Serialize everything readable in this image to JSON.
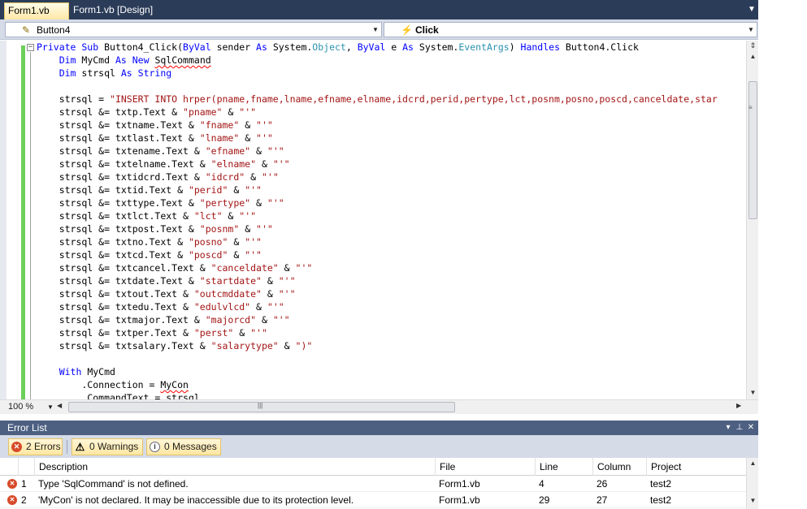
{
  "tabs": [
    {
      "label": "Form1.vb",
      "active": true
    },
    {
      "label": "Form1.vb [Design]",
      "active": false
    }
  ],
  "tab_menu_icon": "dropdown-arrow",
  "nav": {
    "object_combo": "Button4",
    "event_combo": "Click"
  },
  "editor": {
    "colors": {
      "keyword": "#0000ff",
      "string": "#a31515",
      "type": "#2b91af",
      "change_bar": "#6ccf5a"
    },
    "lines": [
      [
        {
          "t": "Private Sub",
          "c": "kw"
        },
        {
          "t": " Button4_Click("
        },
        {
          "t": "ByVal",
          "c": "kw"
        },
        {
          "t": " sender "
        },
        {
          "t": "As",
          "c": "kw"
        },
        {
          "t": " System."
        },
        {
          "t": "Object",
          "c": "typ"
        },
        {
          "t": ", "
        },
        {
          "t": "ByVal",
          "c": "kw"
        },
        {
          "t": " e "
        },
        {
          "t": "As",
          "c": "kw"
        },
        {
          "t": " System."
        },
        {
          "t": "EventArgs",
          "c": "typ"
        },
        {
          "t": ") "
        },
        {
          "t": "Handles",
          "c": "kw"
        },
        {
          "t": " Button4.Click"
        }
      ],
      [
        {
          "t": "    "
        },
        {
          "t": "Dim",
          "c": "kw"
        },
        {
          "t": " MyCmd "
        },
        {
          "t": "As New",
          "c": "kw"
        },
        {
          "t": " "
        },
        {
          "t": "SqlCommand",
          "c": "squig"
        }
      ],
      [
        {
          "t": "    "
        },
        {
          "t": "Dim",
          "c": "kw"
        },
        {
          "t": " strsql "
        },
        {
          "t": "As String",
          "c": "kw"
        }
      ],
      [],
      [
        {
          "t": "    strsql = "
        },
        {
          "t": "\"INSERT INTO hrper(pname,fname,lname,efname,elname,idcrd,perid,pertype,lct,posnm,posno,poscd,canceldate,star",
          "c": "str"
        }
      ],
      [
        {
          "t": "    strsql &= txtp.Text & "
        },
        {
          "t": "\"pname\"",
          "c": "str"
        },
        {
          "t": " & "
        },
        {
          "t": "\"'\"",
          "c": "str"
        }
      ],
      [
        {
          "t": "    strsql &= txtname.Text & "
        },
        {
          "t": "\"fname\"",
          "c": "str"
        },
        {
          "t": " & "
        },
        {
          "t": "\"'\"",
          "c": "str"
        }
      ],
      [
        {
          "t": "    strsql &= txtlast.Text & "
        },
        {
          "t": "\"lname\"",
          "c": "str"
        },
        {
          "t": " & "
        },
        {
          "t": "\"'\"",
          "c": "str"
        }
      ],
      [
        {
          "t": "    strsql &= txtename.Text & "
        },
        {
          "t": "\"efname\"",
          "c": "str"
        },
        {
          "t": " & "
        },
        {
          "t": "\"'\"",
          "c": "str"
        }
      ],
      [
        {
          "t": "    strsql &= txtelname.Text & "
        },
        {
          "t": "\"elname\"",
          "c": "str"
        },
        {
          "t": " & "
        },
        {
          "t": "\"'\"",
          "c": "str"
        }
      ],
      [
        {
          "t": "    strsql &= txtidcrd.Text & "
        },
        {
          "t": "\"idcrd\"",
          "c": "str"
        },
        {
          "t": " & "
        },
        {
          "t": "\"'\"",
          "c": "str"
        }
      ],
      [
        {
          "t": "    strsql &= txtid.Text & "
        },
        {
          "t": "\"perid\"",
          "c": "str"
        },
        {
          "t": " & "
        },
        {
          "t": "\"'\"",
          "c": "str"
        }
      ],
      [
        {
          "t": "    strsql &= txttype.Text & "
        },
        {
          "t": "\"pertype\"",
          "c": "str"
        },
        {
          "t": " & "
        },
        {
          "t": "\"'\"",
          "c": "str"
        }
      ],
      [
        {
          "t": "    strsql &= txtlct.Text & "
        },
        {
          "t": "\"lct\"",
          "c": "str"
        },
        {
          "t": " & "
        },
        {
          "t": "\"'\"",
          "c": "str"
        }
      ],
      [
        {
          "t": "    strsql &= txtpost.Text & "
        },
        {
          "t": "\"posnm\"",
          "c": "str"
        },
        {
          "t": " & "
        },
        {
          "t": "\"'\"",
          "c": "str"
        }
      ],
      [
        {
          "t": "    strsql &= txtno.Text & "
        },
        {
          "t": "\"posno\"",
          "c": "str"
        },
        {
          "t": " & "
        },
        {
          "t": "\"'\"",
          "c": "str"
        }
      ],
      [
        {
          "t": "    strsql &= txtcd.Text & "
        },
        {
          "t": "\"poscd\"",
          "c": "str"
        },
        {
          "t": " & "
        },
        {
          "t": "\"'\"",
          "c": "str"
        }
      ],
      [
        {
          "t": "    strsql &= txtcancel.Text & "
        },
        {
          "t": "\"canceldate\"",
          "c": "str"
        },
        {
          "t": " & "
        },
        {
          "t": "\"'\"",
          "c": "str"
        }
      ],
      [
        {
          "t": "    strsql &= txtdate.Text & "
        },
        {
          "t": "\"startdate\"",
          "c": "str"
        },
        {
          "t": " & "
        },
        {
          "t": "\"'\"",
          "c": "str"
        }
      ],
      [
        {
          "t": "    strsql &= txtout.Text & "
        },
        {
          "t": "\"outcmddate\"",
          "c": "str"
        },
        {
          "t": " & "
        },
        {
          "t": "\"'\"",
          "c": "str"
        }
      ],
      [
        {
          "t": "    strsql &= txtedu.Text & "
        },
        {
          "t": "\"edulvlcd\"",
          "c": "str"
        },
        {
          "t": " & "
        },
        {
          "t": "\"'\"",
          "c": "str"
        }
      ],
      [
        {
          "t": "    strsql &= txtmajor.Text & "
        },
        {
          "t": "\"majorcd\"",
          "c": "str"
        },
        {
          "t": " & "
        },
        {
          "t": "\"'\"",
          "c": "str"
        }
      ],
      [
        {
          "t": "    strsql &= txtper.Text & "
        },
        {
          "t": "\"perst\"",
          "c": "str"
        },
        {
          "t": " & "
        },
        {
          "t": "\"'\"",
          "c": "str"
        }
      ],
      [
        {
          "t": "    strsql &= txtsalary.Text & "
        },
        {
          "t": "\"salarytype\"",
          "c": "str"
        },
        {
          "t": " & "
        },
        {
          "t": "\")\"",
          "c": "str"
        }
      ],
      [],
      [
        {
          "t": "    "
        },
        {
          "t": "With",
          "c": "kw"
        },
        {
          "t": " MyCmd"
        }
      ],
      [
        {
          "t": "        .Connection = "
        },
        {
          "t": "MyCon",
          "c": "squig"
        }
      ],
      [
        {
          "t": "        .CommandText = strsql"
        }
      ]
    ]
  },
  "zoom": "100 %",
  "error_list": {
    "title": "Error List",
    "filters": {
      "errors": "2 Errors",
      "warnings": "0 Warnings",
      "messages": "0 Messages"
    },
    "columns": [
      "Description",
      "File",
      "Line",
      "Column",
      "Project"
    ],
    "rows": [
      {
        "num": "1",
        "description": "Type 'SqlCommand' is not defined.",
        "file": "Form1.vb",
        "line": "4",
        "column": "26",
        "project": "test2"
      },
      {
        "num": "2",
        "description": "'MyCon' is not declared. It may be inaccessible due to its protection level.",
        "file": "Form1.vb",
        "line": "29",
        "column": "27",
        "project": "test2"
      }
    ]
  }
}
